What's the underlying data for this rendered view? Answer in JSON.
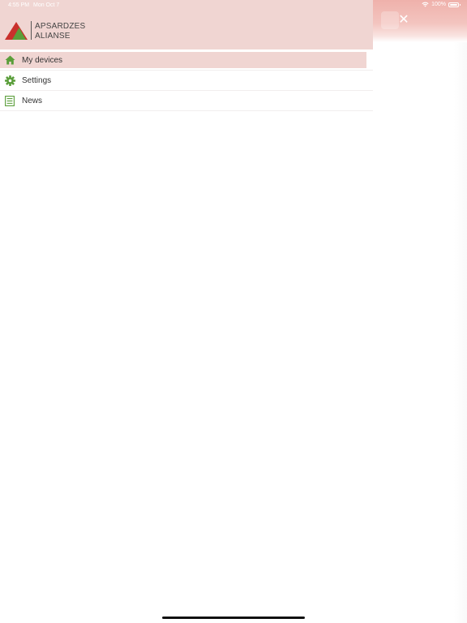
{
  "status_bar": {
    "time": "4:55 PM",
    "date": "Mon Oct 7",
    "battery": "100%"
  },
  "brand": {
    "line1": "APSARDZES",
    "line2": "ALIANSE",
    "colors": {
      "red": "#c9302c",
      "green": "#5a9e3a",
      "header_bg": "#f0d5d2"
    }
  },
  "menu": {
    "items": [
      {
        "label": "My devices",
        "icon": "home-icon",
        "active": true
      },
      {
        "label": "Settings",
        "icon": "gear-icon",
        "active": false
      },
      {
        "label": "News",
        "icon": "news-list-icon",
        "active": false
      }
    ]
  },
  "background": {
    "close_glyph": "✕"
  }
}
